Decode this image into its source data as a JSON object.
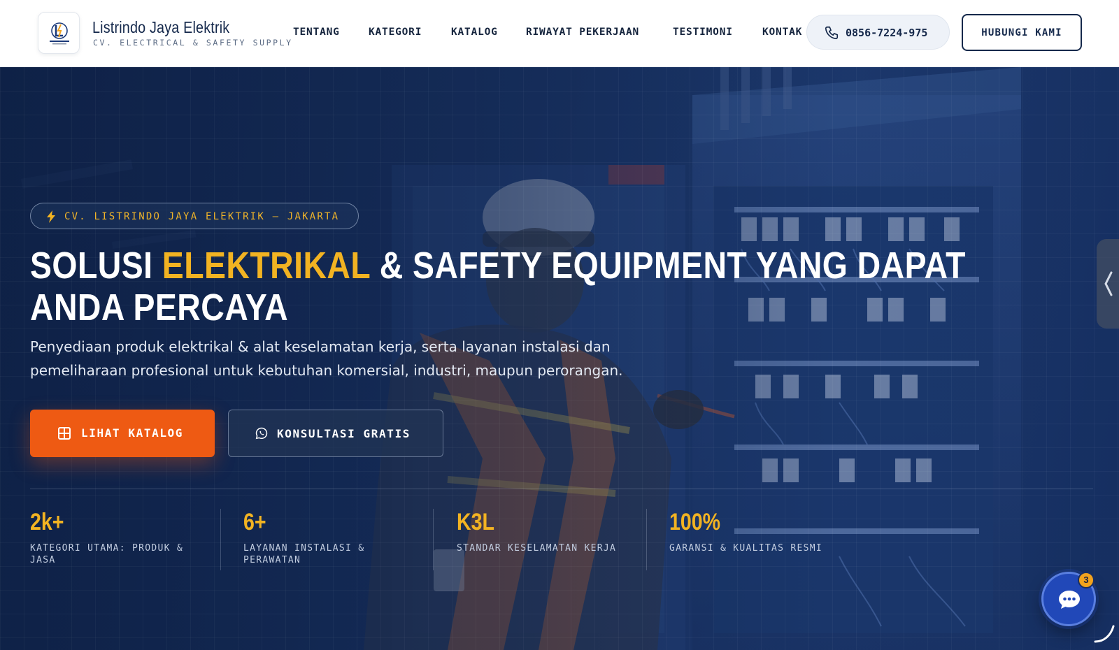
{
  "brand": {
    "name": "Listrindo Jaya Elektrik",
    "tagline": "CV. ELECTRICAL & SAFETY SUPPLY"
  },
  "nav": {
    "items": [
      {
        "label": "TENTANG"
      },
      {
        "label": "KATEGORI"
      },
      {
        "label": "KATALOG"
      },
      {
        "label": "RIWAYAT PEKERJAAN"
      },
      {
        "label": "TESTIMONI"
      },
      {
        "label": "KONTAK"
      }
    ],
    "phone": "0856-7224-975",
    "cta_label": "HUBUNGI KAMI"
  },
  "hero": {
    "badge": "CV. LISTRINDO JAYA ELEKTRIK — JAKARTA",
    "headline": {
      "part1": "SOLUSI ",
      "highlight": "ELEKTRIKAL",
      "part2": " & SAFETY EQUIPMENT YANG DAPAT",
      "line2": "ANDA PERCAYA"
    },
    "subtext": "Penyediaan produk elektrikal & alat keselamatan kerja, serta layanan instalasi dan pemeliharaan profesional untuk kebutuhan komersial, industri, maupun perorangan.",
    "primary_button": "LIHAT KATALOG",
    "secondary_button": "KONSULTASI GRATIS",
    "stats": [
      {
        "value": "2k+",
        "label": "KATEGORI UTAMA: PRODUK & JASA"
      },
      {
        "value": "6+",
        "label": "LAYANAN INSTALASI & PERAWATAN"
      },
      {
        "value": "K3L",
        "label": "STANDAR KESELAMATAN KERJA"
      },
      {
        "value": "100%",
        "label": "GARANSI & KUALITAS RESMI"
      }
    ]
  },
  "chat": {
    "unread_count": "3"
  },
  "icons": {
    "logo": "company-logo",
    "phone": "phone-icon",
    "bolt": "lightning-bolt-icon",
    "catalog": "grid-icon",
    "whatsapp": "whatsapp-icon",
    "chat": "chat-bubble-icon",
    "side_tab": "chevron-left-icon"
  },
  "colors": {
    "accent_yellow": "#f2b322",
    "primary_orange": "#ee5a13",
    "navy": "#14284b",
    "hero_blue": "#173162"
  }
}
